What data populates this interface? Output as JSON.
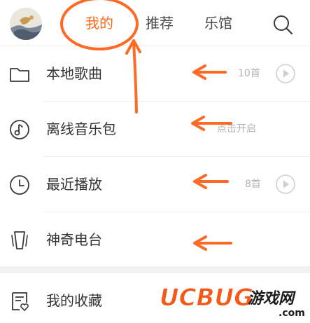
{
  "header": {
    "tabs": [
      {
        "label": "我的",
        "active": true
      },
      {
        "label": "推荐",
        "active": false
      },
      {
        "label": "乐馆",
        "active": false
      }
    ]
  },
  "list": [
    {
      "label": "本地歌曲",
      "meta": "10首",
      "icon": "folder-icon",
      "has_play": true
    },
    {
      "label": "离线音乐包",
      "meta": "点击开启",
      "icon": "music-note-icon",
      "has_play": false
    },
    {
      "label": "最近播放",
      "meta": "8首",
      "icon": "clock-icon",
      "has_play": true
    },
    {
      "label": "神奇电台",
      "meta": "",
      "icon": "phone-radio-icon",
      "has_play": false
    }
  ],
  "favorites": {
    "label": "我的收藏",
    "icon": "favorites-list-icon"
  },
  "watermark": {
    "brand": "UCBUG",
    "site": "游戏网",
    "domain": ".com"
  },
  "colors": {
    "accent": "#ff6a1e",
    "annotation": "#ff6a26",
    "text": "#333333",
    "meta": "#b3b3b3",
    "divider": "#ececec"
  }
}
